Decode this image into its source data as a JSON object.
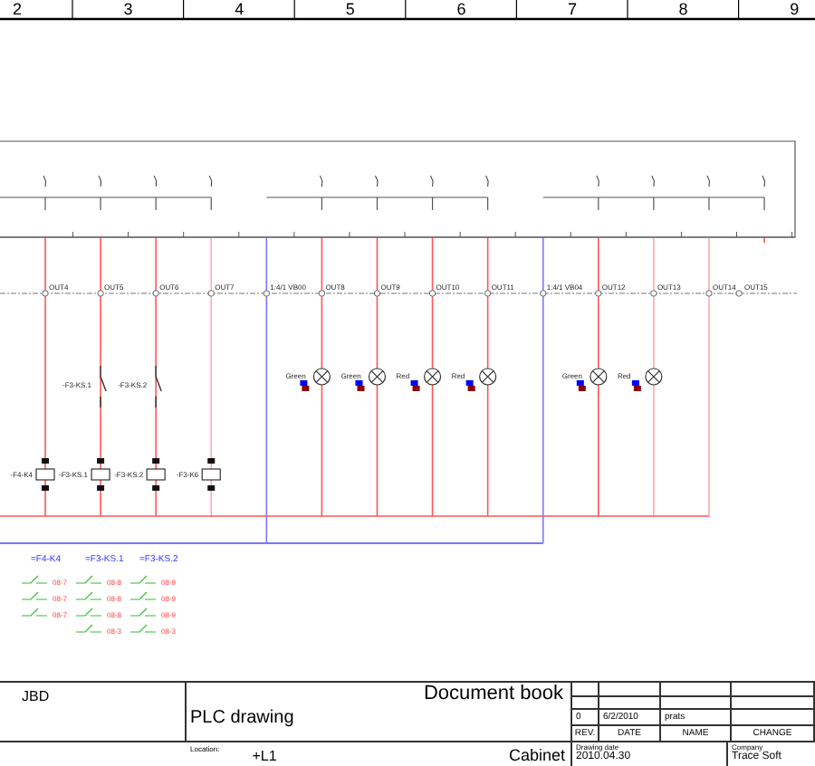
{
  "ruler": {
    "columns": [
      "2",
      "3",
      "4",
      "5",
      "6",
      "7",
      "8",
      "9"
    ]
  },
  "wires": [
    {
      "label": "OUT4",
      "kind": "signal",
      "devices": [
        {
          "kind": "coil",
          "label": "-F4-K4"
        }
      ]
    },
    {
      "label": "OUT5",
      "kind": "signal",
      "devices": [
        {
          "kind": "contact",
          "label": "-F3-KS.1"
        },
        {
          "kind": "coil",
          "label": "-F3-KS.1"
        }
      ]
    },
    {
      "label": "OUT6",
      "kind": "signal",
      "devices": [
        {
          "kind": "contact",
          "label": "-F3-KS.2"
        },
        {
          "kind": "coil",
          "label": "-F3-KS.2"
        }
      ]
    },
    {
      "label": "OUT7",
      "kind": "faded",
      "devices": [
        {
          "kind": "coil",
          "label": "-F3-K6"
        }
      ]
    },
    {
      "label": "1:4/1 VB00",
      "kind": "common"
    },
    {
      "label": "OUT8",
      "kind": "signal",
      "devices": [
        {
          "kind": "lamp",
          "label": "Green"
        }
      ]
    },
    {
      "label": "OUT9",
      "kind": "signal",
      "devices": [
        {
          "kind": "lamp",
          "label": "Green"
        }
      ]
    },
    {
      "label": "OUT10",
      "kind": "signal",
      "devices": [
        {
          "kind": "lamp",
          "label": "Red"
        }
      ]
    },
    {
      "label": "OUT11",
      "kind": "signal",
      "devices": [
        {
          "kind": "lamp",
          "label": "Red"
        }
      ]
    },
    {
      "label": "1:4/1 VB04",
      "kind": "common"
    },
    {
      "label": "OUT12",
      "kind": "signal",
      "devices": [
        {
          "kind": "lamp",
          "label": "Green"
        }
      ]
    },
    {
      "label": "OUT13",
      "kind": "faded",
      "devices": [
        {
          "kind": "lamp",
          "label": "Red"
        }
      ]
    },
    {
      "label": "OUT14",
      "kind": "faded"
    },
    {
      "label": "OUT15",
      "kind": "stub"
    }
  ],
  "cross_refs": [
    {
      "label": "=F4-K4",
      "refs": [
        "08-7",
        "08-7",
        "08-7"
      ]
    },
    {
      "label": "=F3-KS.1",
      "refs": [
        "08-8",
        "08-8",
        "08-8",
        "08-3"
      ]
    },
    {
      "label": "=F3-KS.2",
      "refs": [
        "08-9",
        "08-9",
        "08-9",
        "08-3"
      ]
    }
  ],
  "title_block": {
    "customer": "JBD",
    "document": "Document book",
    "drawing": "PLC drawing",
    "location_label": "Location:",
    "location": "+L1",
    "cabinet": "Cabinet",
    "revision": {
      "rev": "0",
      "date": "6/2/2010",
      "name": "prats"
    },
    "rev_headers": [
      "REV.",
      "DATE",
      "NAME",
      "CHANGE"
    ],
    "drawing_date_label": "Drawing date",
    "drawing_date": "2010.04.30",
    "company_label": "Company",
    "company": "Trace Soft"
  }
}
